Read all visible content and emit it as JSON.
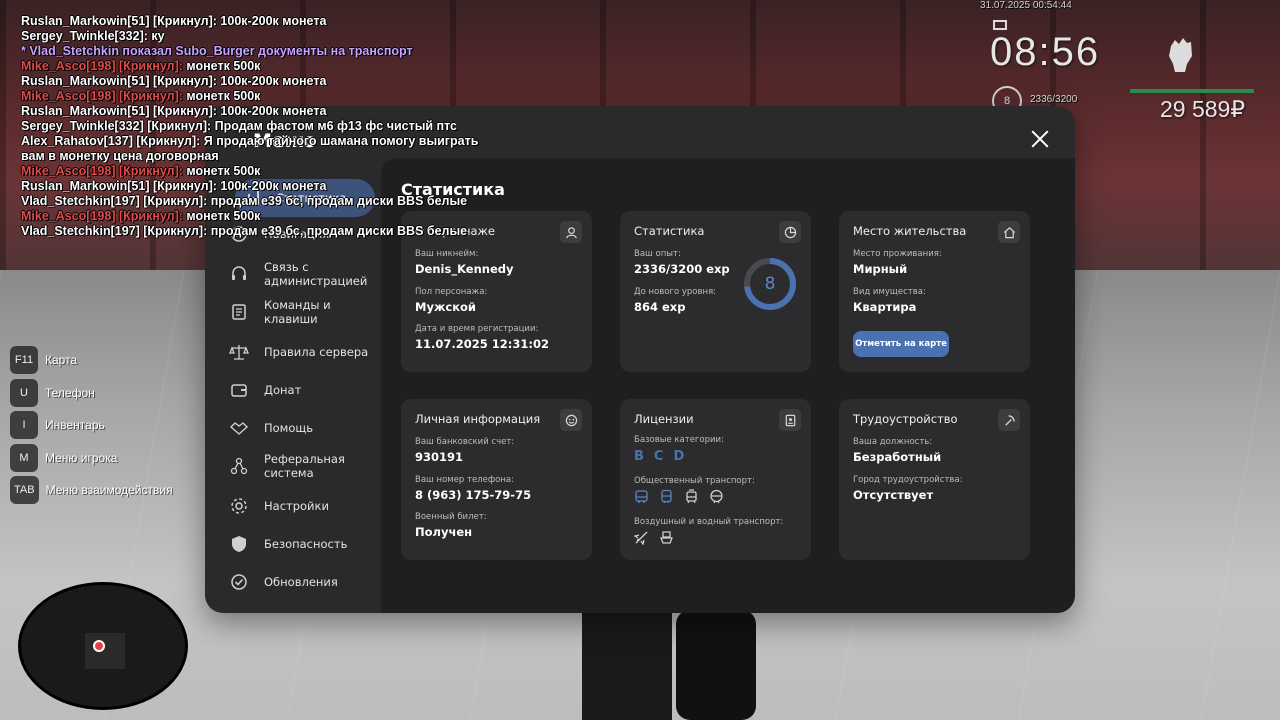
{
  "chat": [
    {
      "name": "Ruslan_Markowin[51] [Крикнул]:",
      "text": " 100к-200к монета",
      "color": "#ffffff"
    },
    {
      "name": "Sergey_Twinkle[332]:",
      "text": " ку",
      "color": "#ffffff"
    },
    {
      "name": "* Vlad_Stetchkin показал Subo_Burger документы на транспорт",
      "text": "",
      "color": "#c9a3ff"
    },
    {
      "name": "Mike_Asco[198] [Крикнул]:",
      "text": " монетк 500к",
      "color": "#e24a4a"
    },
    {
      "name": "Ruslan_Markowin[51] [Крикнул]:",
      "text": " 100к-200к монета",
      "color": "#ffffff"
    },
    {
      "name": "Mike_Asco[198] [Крикнул]:",
      "text": " монетк 500к",
      "color": "#e24a4a"
    },
    {
      "name": "Ruslan_Markowin[51] [Крикнул]:",
      "text": " 100к-200к монета",
      "color": "#ffffff"
    },
    {
      "name": "Sergey_Twinkle[332] [Крикнул]:",
      "text": " Продам фастом м6 ф13 фс чистый птс",
      "color": "#ffffff"
    },
    {
      "name": "Alex_Rahatov[137] [Крикнул]:",
      "text": " Я продаю тайного шамана помогу выиграть",
      "color": "#ffffff"
    },
    {
      "name": "",
      "text": " вам в монетку цена договорная",
      "color": "#ffffff"
    },
    {
      "name": "Mike_Asco[198] [Крикнул]:",
      "text": " монетк 500к",
      "color": "#e24a4a"
    },
    {
      "name": "Ruslan_Markowin[51] [Крикнул]:",
      "text": " 100к-200к монета",
      "color": "#ffffff"
    },
    {
      "name": "Vlad_Stetchkin[197] [Крикнул]:",
      "text": " продам е39 бс, продам диски BBS белые",
      "color": "#ffffff"
    },
    {
      "name": "Mike_Asco[198] [Крикнул]:",
      "text": " монетк 500к",
      "color": "#e24a4a"
    },
    {
      "name": "Vlad_Stetchkin[197] [Крикнул]:",
      "text": " продам е39 бс, продам диски BBS белые",
      "color": "#ffffff"
    }
  ],
  "hud": {
    "date": "31.07.2025 00:54:44",
    "time": "08:56",
    "level": "8",
    "exp": "2336/3200",
    "money": "29 589₽",
    "health": 1.0
  },
  "hints": [
    {
      "key": "F11",
      "label": "Карта"
    },
    {
      "key": "U",
      "label": "Телефон"
    },
    {
      "key": "I",
      "label": "Инвентарь"
    },
    {
      "key": "M",
      "label": "Меню игрока"
    },
    {
      "key": "TAB",
      "label": "Меню взаимодействия"
    }
  ],
  "menu": {
    "title": "Меню",
    "sidebar": [
      {
        "label": "Статистика",
        "icon": "chart-icon",
        "active": true
      },
      {
        "label": "Навигация",
        "icon": "compass-icon",
        "active": false
      },
      {
        "label": "Связь с администрацией",
        "icon": "headset-icon",
        "active": false
      },
      {
        "label": "Команды и клавиши",
        "icon": "document-icon",
        "active": false
      },
      {
        "label": "Правила сервера",
        "icon": "scales-icon",
        "active": false
      },
      {
        "label": "Донат",
        "icon": "wallet-icon",
        "active": false
      },
      {
        "label": "Помощь",
        "icon": "handshake-icon",
        "active": false
      },
      {
        "label": "Реферальная система",
        "icon": "network-icon",
        "active": false
      },
      {
        "label": "Настройки",
        "icon": "gear-icon",
        "active": false
      },
      {
        "label": "Безопасность",
        "icon": "shield-icon",
        "active": false
      },
      {
        "label": "Обновления",
        "icon": "check-circle-icon",
        "active": false
      }
    ],
    "content_title": "Статистика",
    "cards": {
      "character": {
        "title": "О персонаже",
        "nickname_label": "Ваш никнейм:",
        "nickname": "Denis_Kennedy",
        "gender_label": "Пол персонажа:",
        "gender": "Мужской",
        "reg_label": "Дата и время регистрации:",
        "reg": "11.07.2025 12:31:02"
      },
      "stats": {
        "title": "Статистика",
        "exp_label": "Ваш опыт:",
        "exp": "2336/3200 exp",
        "next_label": "До нового уровня:",
        "next": "864 exp",
        "level": "8",
        "progress": 0.73
      },
      "residence": {
        "title": "Место жительства",
        "place_label": "Место проживания:",
        "place": "Мирный",
        "property_label": "Вид имущества:",
        "property": "Квартира",
        "map_button": "Отметить на карте"
      },
      "personal": {
        "title": "Личная информация",
        "bank_label": "Ваш банковский счет:",
        "bank": "930191",
        "phone_label": "Ваш номер телефона:",
        "phone": "8 (963) 175-79-75",
        "military_label": "Военный билет:",
        "military": "Получен"
      },
      "licenses": {
        "title": "Лицензии",
        "base_label": "Базовые категории:",
        "categories": [
          "B",
          "C",
          "D"
        ],
        "public_label": "Общественный транспорт:",
        "air_label": "Воздушный и водный транспорт:"
      },
      "employment": {
        "title": "Трудоустройство",
        "position_label": "Ваша должность:",
        "position": "Безработный",
        "city_label": "Город трудоустройства:",
        "city": "Отсутствует"
      }
    }
  },
  "colors": {
    "accent": "#4a72b0",
    "panel": "#2a2a2c",
    "content": "#1f1f21",
    "card": "#2c2c2e",
    "chat_red": "#e24a4a",
    "chat_purple": "#c9a3ff"
  }
}
